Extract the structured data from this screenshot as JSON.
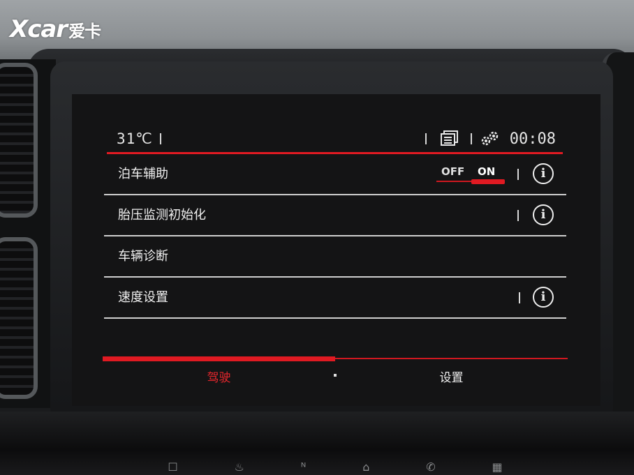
{
  "watermark": {
    "brand": "Xcar",
    "sub": "爱卡"
  },
  "status_bar": {
    "temperature": "31℃",
    "clock": "00:08"
  },
  "menu": {
    "items": [
      {
        "label": "泊车辅助",
        "toggle": {
          "off_label": "OFF",
          "on_label": "ON",
          "state": "ON"
        },
        "has_info": true
      },
      {
        "label": "胎压监测初始化",
        "has_info": true
      },
      {
        "label": "车辆诊断",
        "has_info": false
      },
      {
        "label": "速度设置",
        "has_info": true
      }
    ]
  },
  "tabs": [
    {
      "label": "驾驶",
      "active": true
    },
    {
      "label": "设置",
      "active": false
    }
  ],
  "icons": [
    "menu-list-icon",
    "gear-icon",
    "info-icon"
  ],
  "colors": {
    "accent": "#e01a22",
    "text": "#f0f0f0",
    "screen_bg": "#141415"
  }
}
